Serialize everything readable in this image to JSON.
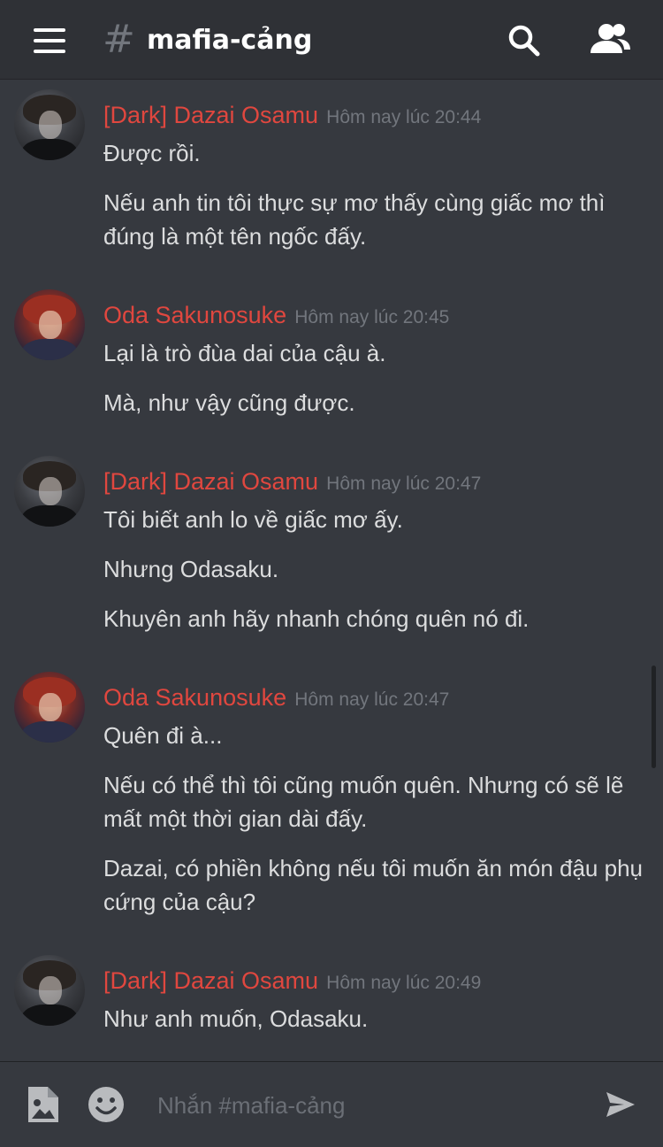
{
  "header": {
    "channel_name": "mafia-cảng",
    "icons": [
      "menu-icon",
      "hash-icon",
      "search-icon",
      "members-icon"
    ]
  },
  "messages": [
    {
      "author": "[Dark] Dazai Osamu",
      "timestamp": "Hôm nay lúc 20:44",
      "avatar": "dazai-avatar",
      "lines": [
        "Được rồi.",
        "Nếu anh tin tôi thực sự mơ thấy cùng giấc mơ thì đúng là một tên ngốc đấy."
      ]
    },
    {
      "author": "Oda Sakunosuke",
      "timestamp": "Hôm nay lúc 20:45",
      "avatar": "oda-avatar",
      "lines": [
        "Lại là trò đùa dai của cậu à.",
        "Mà, như vậy cũng được."
      ]
    },
    {
      "author": "[Dark] Dazai Osamu",
      "timestamp": "Hôm nay lúc 20:47",
      "avatar": "dazai-avatar",
      "lines": [
        "Tôi biết anh lo về giấc mơ ấy.",
        "Nhưng Odasaku.",
        "Khuyên anh hãy nhanh chóng quên nó đi."
      ]
    },
    {
      "author": "Oda Sakunosuke",
      "timestamp": "Hôm nay lúc 20:47",
      "avatar": "oda-avatar",
      "lines": [
        "Quên đi à...",
        "Nếu có thể thì tôi cũng muốn quên. Nhưng có sẽ lẽ mất một thời gian dài đấy.",
        "Dazai, có phiền không nếu tôi muốn ăn món đậu phụ cứng của cậu?"
      ]
    },
    {
      "author": "[Dark] Dazai Osamu",
      "timestamp": "Hôm nay lúc 20:49",
      "avatar": "dazai-avatar",
      "lines": [
        "Như anh muốn, Odasaku."
      ]
    }
  ],
  "composer": {
    "placeholder": "Nhắn #mafia-cảng",
    "icons": [
      "image-icon",
      "emoji-icon",
      "send-icon"
    ]
  },
  "colors": {
    "background": "#36393f",
    "topbar": "#2f3136",
    "author_name": "#e0473f",
    "timestamp": "#72767d",
    "message_text": "#dcddde"
  }
}
